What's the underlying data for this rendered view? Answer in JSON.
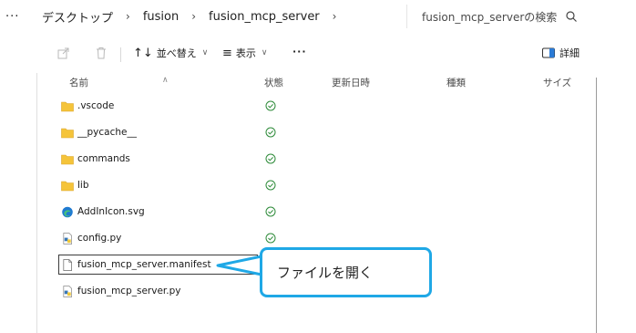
{
  "address": {
    "more": "···",
    "breadcrumbs": [
      "デスクトップ",
      "fusion",
      "fusion_mcp_server"
    ],
    "search_placeholder": "fusion_mcp_serverの検索"
  },
  "toolbar": {
    "sort_label": "並べ替え",
    "view_label": "表示",
    "more_label": "···",
    "details_label": "詳細"
  },
  "columns": {
    "name": "名前",
    "status": "状態",
    "modified": "更新日時",
    "type": "種類",
    "size": "サイズ"
  },
  "files": [
    {
      "name": ".vscode",
      "icon": "folder-icon",
      "synced": true
    },
    {
      "name": "__pycache__",
      "icon": "folder-icon",
      "synced": true
    },
    {
      "name": "commands",
      "icon": "folder-icon",
      "synced": true
    },
    {
      "name": "lib",
      "icon": "folder-icon",
      "synced": true
    },
    {
      "name": "AddInIcon.svg",
      "icon": "edge-svg-icon",
      "synced": true
    },
    {
      "name": "config.py",
      "icon": "python-file-icon",
      "synced": true
    },
    {
      "name": "fusion_mcp_server.manifest",
      "icon": "document-icon",
      "synced": false,
      "selected": true
    },
    {
      "name": "fusion_mcp_server.py",
      "icon": "python-file-icon",
      "synced": false
    }
  ],
  "callout": {
    "text": "ファイルを開く",
    "color": "#1fa8e6"
  },
  "colors": {
    "folder": "#f5c43a",
    "sync_ok": "#2e8b3a"
  }
}
